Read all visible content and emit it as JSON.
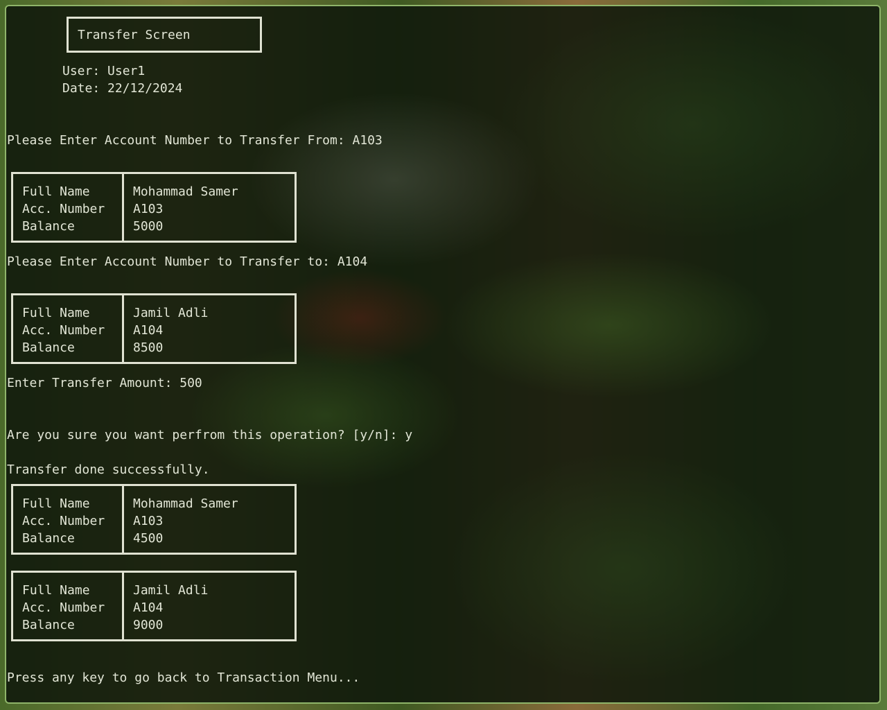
{
  "screen": {
    "title": "Transfer Screen",
    "user_line": "User: User1",
    "date_line": "Date: 22/12/2024"
  },
  "labels": {
    "full_name": "Full Name",
    "acc_number": "Acc. Number",
    "balance": "Balance"
  },
  "prompts": {
    "from_account": "Please Enter Account Number to Transfer From: A103",
    "to_account": "Please Enter Account Number to Transfer to: A104",
    "amount": "Enter Transfer Amount: 500",
    "confirm": "Are you sure you want perfrom this operation? [y/n]: y",
    "success": "Transfer done successfully.",
    "back": "Press any key to go back to Transaction Menu..."
  },
  "accounts": {
    "from_before": {
      "full_name": "Mohammad Samer",
      "acc_number": "A103",
      "balance": "5000"
    },
    "to_before": {
      "full_name": "Jamil Adli",
      "acc_number": "A104",
      "balance": "8500"
    },
    "from_after": {
      "full_name": "Mohammad Samer",
      "acc_number": "A103",
      "balance": "4500"
    },
    "to_after": {
      "full_name": "Jamil Adli",
      "acc_number": "A104",
      "balance": "9000"
    }
  }
}
